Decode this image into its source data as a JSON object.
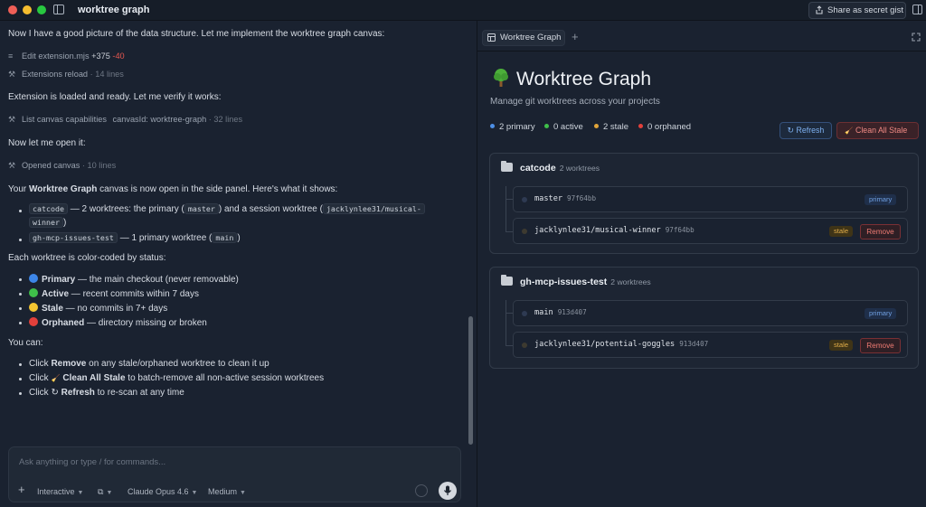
{
  "window": {
    "title": "worktree graph",
    "share_label": "Share as secret gist"
  },
  "chat": {
    "msg1": "Now I have a good picture of the data structure. Let me implement the worktree graph canvas:",
    "tool_edit": {
      "label": "Edit extension.mjs",
      "added": "+375",
      "removed": "-40"
    },
    "tool_reload": {
      "label": "Extensions reload",
      "meta": "· 14 lines"
    },
    "msg2": "Extension is loaded and ready. Let me verify it works:",
    "tool_list": {
      "label": "List canvas capabilities",
      "arg": "canvasId: worktree-graph",
      "meta": "· 32 lines"
    },
    "msg3": "Now let me open it:",
    "tool_open": {
      "label": "Opened canvas",
      "meta": "· 10 lines"
    },
    "msg4": {
      "pre": "Your ",
      "bold": "Worktree Graph",
      "post": " canvas is now open in the side panel. Here's what it shows:"
    },
    "bullets1": {
      "b1_code": "catcode",
      "b1_text": " — 2 worktrees: the primary (",
      "b1_code2": "master",
      "b1_text2": ") and a session worktree (",
      "b1_code3": "jacklynlee31/musical-",
      "b1_code3b": "winner",
      "b1_end": ")",
      "b2_code": "gh-mcp-issues-test",
      "b2_text": " — 1 primary worktree (",
      "b2_code2": "main",
      "b2_end": ")"
    },
    "msg5": "Each worktree is color-coded by status:",
    "statuses": [
      {
        "bold": "Primary",
        "text": " — the main checkout (never removable)",
        "color": "#3d86e8"
      },
      {
        "bold": "Active",
        "text": " — recent commits within 7 days",
        "color": "#3fbf4a"
      },
      {
        "bold": "Stale",
        "text": " — no commits in 7+ days",
        "color": "#f4c531"
      },
      {
        "bold": "Orphaned",
        "text": " — directory missing or broken",
        "color": "#e2403b"
      }
    ],
    "msg6": "You can:",
    "actions": [
      {
        "pre": "Click ",
        "bold": "Remove",
        "post": " on any stale/orphaned worktree to clean it up"
      },
      {
        "pre": "Click ",
        "bold": "Clean All Stale",
        "post": " to batch-remove all non-active session worktrees"
      },
      {
        "pre": "Click ",
        "bold": "Refresh",
        "post": " to re-scan at any time"
      }
    ]
  },
  "composer": {
    "placeholder": "Ask anything or type / for commands...",
    "mode": "Interactive",
    "model": "Claude Opus 4.6",
    "effort": "Medium"
  },
  "panel": {
    "tab_label": "Worktree Graph",
    "title": "Worktree Graph",
    "subtitle": "Manage git worktrees across your projects",
    "stats": [
      {
        "label": "2 primary",
        "color": "#4d8fe6"
      },
      {
        "label": "0 active",
        "color": "#3fbf4a"
      },
      {
        "label": "2 stale",
        "color": "#e0a43a"
      },
      {
        "label": "0 orphaned",
        "color": "#e2403b"
      }
    ],
    "refresh_label": "Refresh",
    "clean_label": "Clean All Stale",
    "repos": [
      {
        "name": "catcode",
        "count": "2 worktrees",
        "worktrees": [
          {
            "branch": "master",
            "hash": "97f64bb",
            "status": "primary",
            "dot": "#2e3a52"
          },
          {
            "branch": "jacklynlee31/musical-winner",
            "hash": "97f64bb",
            "status": "stale",
            "dot": "#3d3a30",
            "remove": "Remove"
          }
        ]
      },
      {
        "name": "gh-mcp-issues-test",
        "count": "2 worktrees",
        "worktrees": [
          {
            "branch": "main",
            "hash": "913d407",
            "status": "primary",
            "dot": "#2e3a52"
          },
          {
            "branch": "jacklynlee31/potential-goggles",
            "hash": "913d407",
            "status": "stale",
            "dot": "#3d3a30",
            "remove": "Remove"
          }
        ]
      }
    ]
  }
}
